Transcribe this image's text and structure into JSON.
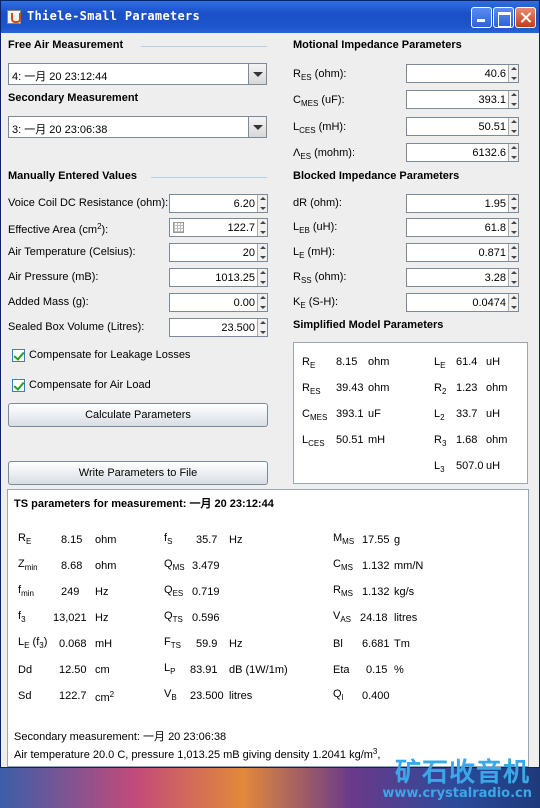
{
  "window": {
    "title": "Thiele-Small Parameters"
  },
  "left": {
    "free_air_heading": "Free Air Measurement",
    "free_air_value": "4: 一月 20 23:12:44",
    "secondary_heading": "Secondary Measurement",
    "secondary_value": "3: 一月 20 23:06:38",
    "manual_heading": "Manually Entered Values",
    "fields": [
      {
        "label": "Voice Coil DC Resistance (ohm):",
        "value": "6.20"
      },
      {
        "label_main": "Effective Area (cm",
        "label_sup": "2",
        "label_end": "):",
        "value": "122.7"
      },
      {
        "label": "Air Temperature (Celsius):",
        "value": "20"
      },
      {
        "label": "Air Pressure (mB):",
        "value": "1013.25"
      },
      {
        "label": "Added Mass (g):",
        "value": "0.00"
      },
      {
        "label": "Sealed Box Volume (Litres):",
        "value": "23.500"
      }
    ],
    "checks": [
      {
        "label": "Compensate for Leakage Losses",
        "checked": true
      },
      {
        "label": "Compensate for Air Load",
        "checked": true
      }
    ],
    "calc_button": "Calculate Parameters",
    "write_button": "Write Parameters to File"
  },
  "right": {
    "motional_heading": "Motional Impedance Parameters",
    "motional": [
      {
        "sym": "R",
        "sub": "ES",
        "unit": " (ohm):",
        "value": "40.6"
      },
      {
        "sym": "C",
        "sub": "MES",
        "unit": " (uF):",
        "value": "393.1"
      },
      {
        "sym": "L",
        "sub": "CES",
        "unit": " (mH):",
        "value": "50.51"
      },
      {
        "sym": "Λ",
        "sub": "ES",
        "unit": " (mohm):",
        "value": "6132.6"
      }
    ],
    "blocked_heading": "Blocked Impedance Parameters",
    "blocked": [
      {
        "sym": "dR",
        "sub": "",
        "unit": " (ohm):",
        "value": "1.95"
      },
      {
        "sym": "L",
        "sub": "EB",
        "unit": " (uH):",
        "value": "61.8"
      },
      {
        "sym": "L",
        "sub": "E",
        "unit": " (mH):",
        "value": "0.871"
      },
      {
        "sym": "R",
        "sub": "SS",
        "unit": " (ohm):",
        "value": "3.28"
      },
      {
        "sym": "K",
        "sub": "E",
        "unit": " (S-H):",
        "value": "0.0474"
      }
    ],
    "simplified_heading": "Simplified Model Parameters",
    "simplified_left": [
      {
        "sym": "R",
        "sub": "E",
        "value": "8.15",
        "unit": "ohm"
      },
      {
        "sym": "R",
        "sub": "ES",
        "value": "39.43",
        "unit": "ohm"
      },
      {
        "sym": "C",
        "sub": "MES",
        "value": "393.1",
        "unit": "uF"
      },
      {
        "sym": "L",
        "sub": "CES",
        "value": "50.51",
        "unit": "mH"
      }
    ],
    "simplified_right": [
      {
        "sym": "L",
        "sub": "E",
        "value": "61.4",
        "unit": "uH"
      },
      {
        "sym": "R",
        "sub": "2",
        "value": "1.23",
        "unit": "ohm"
      },
      {
        "sym": "L",
        "sub": "2",
        "value": "33.7",
        "unit": "uH"
      },
      {
        "sym": "R",
        "sub": "3",
        "value": "1.68",
        "unit": "ohm"
      },
      {
        "sym": "L",
        "sub": "3",
        "value": "507.0",
        "unit": "uH"
      }
    ]
  },
  "ts": {
    "heading": "TS parameters for measurement: 一月 20 23:12:44",
    "col1": [
      {
        "sym": "R",
        "sub": "E",
        "value": "8.15",
        "unit": "ohm"
      },
      {
        "sym": "Z",
        "sub": "min",
        "value": "8.68",
        "unit": "ohm"
      },
      {
        "sym": "f",
        "sub": "min",
        "value": "249",
        "unit": "Hz"
      },
      {
        "sym": "f",
        "sub": "3",
        "value": "13,021",
        "unit": "Hz"
      },
      {
        "sym": "L",
        "sub": "E",
        "extra": " (f",
        "extra_sub": "3",
        "extra_end": ")",
        "value": "0.068",
        "unit": "mH"
      },
      {
        "sym": "Dd",
        "sub": "",
        "value": "12.50",
        "unit": "cm"
      },
      {
        "sym": "Sd",
        "sub": "",
        "value": "122.7",
        "unit": "cm",
        "unit_sup": "2"
      }
    ],
    "col2": [
      {
        "sym": "f",
        "sub": "S",
        "value": "35.7",
        "unit": "Hz"
      },
      {
        "sym": "Q",
        "sub": "MS",
        "value": "3.479",
        "unit": ""
      },
      {
        "sym": "Q",
        "sub": "ES",
        "value": "0.719",
        "unit": ""
      },
      {
        "sym": "Q",
        "sub": "TS",
        "value": "0.596",
        "unit": ""
      },
      {
        "sym": "F",
        "sub": "TS",
        "value": "59.9",
        "unit": "Hz"
      },
      {
        "sym": "L",
        "sub": "P",
        "value": "83.91",
        "unit": "dB (1W/1m)"
      },
      {
        "sym": "V",
        "sub": "B",
        "value": "23.500",
        "unit": "litres"
      }
    ],
    "col3": [
      {
        "sym": "M",
        "sub": "MS",
        "value": "17.55",
        "unit": "g"
      },
      {
        "sym": "C",
        "sub": "MS",
        "value": "1.132",
        "unit": "mm/N"
      },
      {
        "sym": "R",
        "sub": "MS",
        "value": "1.132",
        "unit": "kg/s"
      },
      {
        "sym": "V",
        "sub": "AS",
        "value": "24.18",
        "unit": "litres"
      },
      {
        "sym": "Bl",
        "sub": "",
        "value": "6.681",
        "unit": "Tm"
      },
      {
        "sym": "Eta",
        "sub": "",
        "value": "0.15",
        "unit": "%"
      },
      {
        "sym": "Q",
        "sub": "l",
        "value": "0.400",
        "unit": ""
      }
    ],
    "secondary_line": "Secondary measurement: 一月 20 23:06:38",
    "air_line_main": "Air temperature 20.0 C, pressure 1,013.25 mB giving density 1.2041 kg/m",
    "air_line_sup": "3",
    "air_line_end": ","
  },
  "watermark": {
    "text": "矿石收音机",
    "url": "www.crystalradio.cn"
  }
}
